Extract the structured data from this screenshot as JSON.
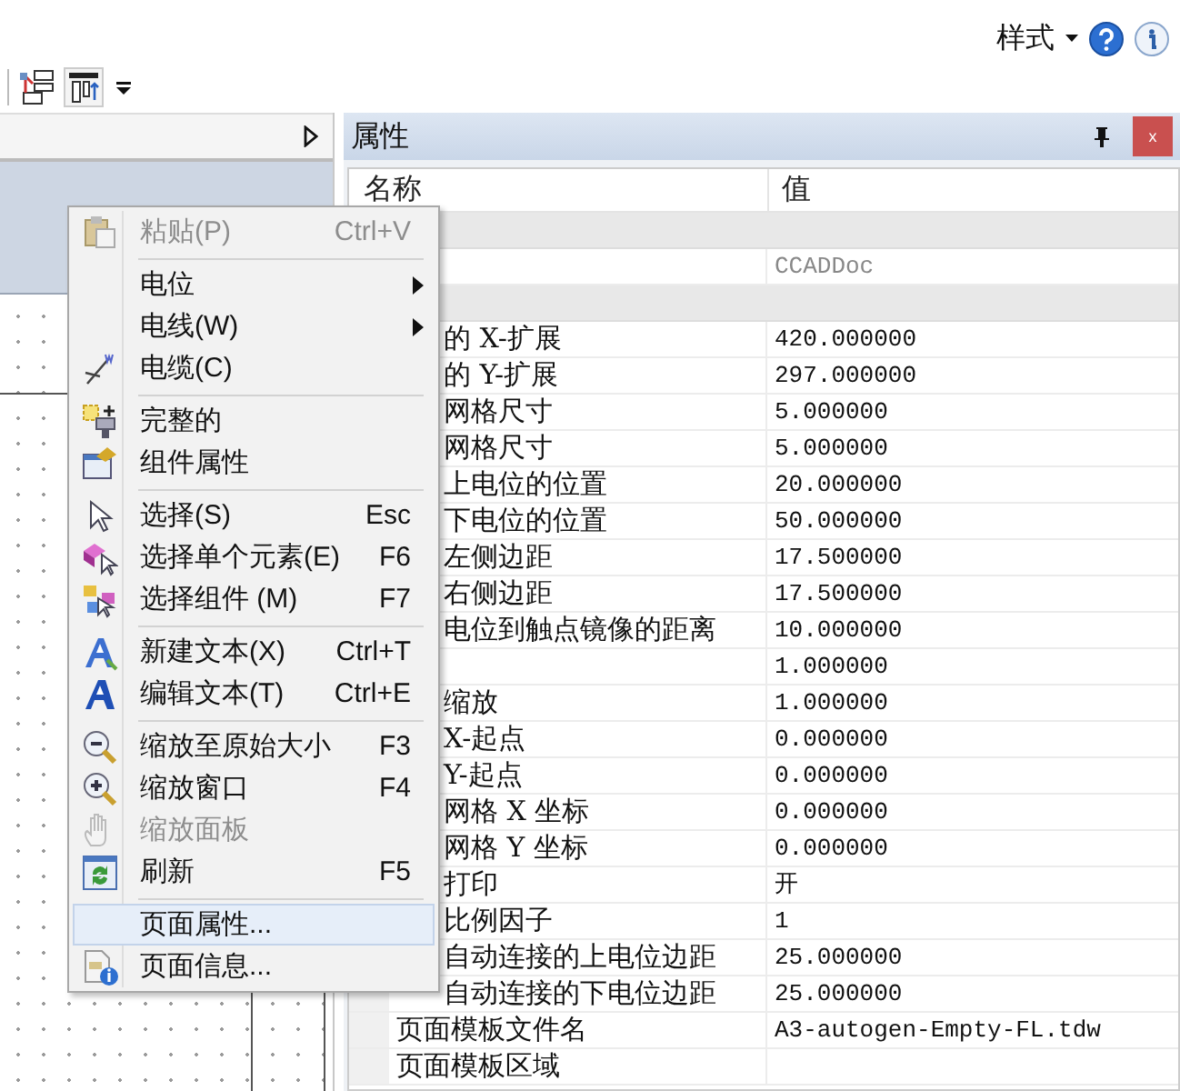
{
  "header": {
    "style_menu": "样式"
  },
  "properties": {
    "title": "属性",
    "close": "x",
    "columns": [
      "名称",
      "值"
    ],
    "rows": [
      {
        "kind": "group"
      },
      {
        "kind": "property",
        "value": "CCADDoc",
        "readonly": true
      },
      {
        "kind": "group"
      },
      {
        "kind": "property",
        "name": "的 X-扩展",
        "value": "420.000000",
        "readonly": false,
        "covered": true
      },
      {
        "kind": "property",
        "name": "的 Y-扩展",
        "value": "297.000000",
        "readonly": false,
        "covered": true
      },
      {
        "kind": "property",
        "name": "网格尺寸",
        "value": "5.000000",
        "readonly": false,
        "covered": true
      },
      {
        "kind": "property",
        "name": "网格尺寸",
        "value": "5.000000",
        "readonly": false,
        "covered": true
      },
      {
        "kind": "property",
        "name": "上电位的位置",
        "value": "20.000000",
        "readonly": false,
        "covered": true
      },
      {
        "kind": "property",
        "name": "下电位的位置",
        "value": "50.000000",
        "readonly": false,
        "covered": true
      },
      {
        "kind": "property",
        "name": "左侧边距",
        "value": "17.500000",
        "readonly": false,
        "covered": true
      },
      {
        "kind": "property",
        "name": "右侧边距",
        "value": "17.500000",
        "readonly": false,
        "covered": true
      },
      {
        "kind": "property",
        "name": "电位到触点镜像的距离",
        "value": "10.000000",
        "readonly": false,
        "covered": true
      },
      {
        "kind": "property",
        "value": "1.000000",
        "readonly": false
      },
      {
        "kind": "property",
        "name": "缩放",
        "value": "1.000000",
        "readonly": false,
        "covered": true
      },
      {
        "kind": "property",
        "name": "X-起点",
        "value": "0.000000",
        "readonly": false,
        "covered": true
      },
      {
        "kind": "property",
        "name": "Y-起点",
        "value": "0.000000",
        "readonly": false,
        "covered": true
      },
      {
        "kind": "property",
        "name": "网格 X 坐标",
        "value": "0.000000",
        "readonly": false,
        "covered": true
      },
      {
        "kind": "property",
        "name": "网格 Y 坐标",
        "value": "0.000000",
        "readonly": false,
        "covered": true
      },
      {
        "kind": "property",
        "name": "打印",
        "value": "开",
        "readonly": false,
        "covered": true
      },
      {
        "kind": "property",
        "name": "比例因子",
        "value": "1",
        "readonly": false,
        "covered": true
      },
      {
        "kind": "property",
        "name": "自动连接的上电位边距",
        "value": "25.000000",
        "readonly": false,
        "covered": true
      },
      {
        "kind": "property",
        "name": "自动连接的下电位边距",
        "value": "25.000000",
        "readonly": false,
        "covered": true
      },
      {
        "kind": "property",
        "name": "页面模板文件名",
        "value": "A3-autogen-Empty-FL.tdw",
        "readonly": false,
        "covered": false
      },
      {
        "kind": "property",
        "name": "页面模板区域",
        "readonly": false,
        "covered": false
      }
    ]
  },
  "context_menu": {
    "items": [
      {
        "kind": "item",
        "label": "粘贴(P)",
        "shortcut": "Ctrl+V",
        "disabled": true,
        "selected": false
      },
      {
        "kind": "separator"
      },
      {
        "kind": "item",
        "label": "电位",
        "disabled": false,
        "submenu": true,
        "selected": false
      },
      {
        "kind": "item",
        "label": "电线(W)",
        "disabled": false,
        "submenu": true,
        "selected": false
      },
      {
        "kind": "item",
        "label": "电缆(C)",
        "disabled": false,
        "selected": false
      },
      {
        "kind": "separator"
      },
      {
        "kind": "item",
        "label": "完整的",
        "disabled": false,
        "selected": false
      },
      {
        "kind": "item",
        "label": "组件属性",
        "disabled": false,
        "selected": false
      },
      {
        "kind": "separator"
      },
      {
        "kind": "item",
        "label": "选择(S)",
        "shortcut": "Esc",
        "disabled": false,
        "selected": false
      },
      {
        "kind": "item",
        "label": "选择单个元素(E)",
        "shortcut": "F6",
        "disabled": false,
        "selected": false
      },
      {
        "kind": "item",
        "label": "选择组件 (M)",
        "shortcut": "F7",
        "disabled": false,
        "selected": false
      },
      {
        "kind": "separator"
      },
      {
        "kind": "item",
        "label": "新建文本(X)",
        "shortcut": "Ctrl+T",
        "disabled": false,
        "selected": false
      },
      {
        "kind": "item",
        "label": "编辑文本(T)",
        "shortcut": "Ctrl+E",
        "disabled": false,
        "selected": false
      },
      {
        "kind": "separator"
      },
      {
        "kind": "item",
        "label": "缩放至原始大小",
        "shortcut": "F3",
        "disabled": false,
        "selected": false
      },
      {
        "kind": "item",
        "label": "缩放窗口",
        "shortcut": "F4",
        "disabled": false,
        "selected": false
      },
      {
        "kind": "item",
        "label": "缩放面板",
        "disabled": true,
        "selected": false
      },
      {
        "kind": "item",
        "label": "刷新",
        "shortcut": "F5",
        "disabled": false,
        "selected": false
      },
      {
        "kind": "separator"
      },
      {
        "kind": "item",
        "label": "页面属性...",
        "disabled": false,
        "selected": true
      },
      {
        "kind": "item",
        "label": "页面信息...",
        "disabled": false,
        "selected": false
      }
    ]
  }
}
